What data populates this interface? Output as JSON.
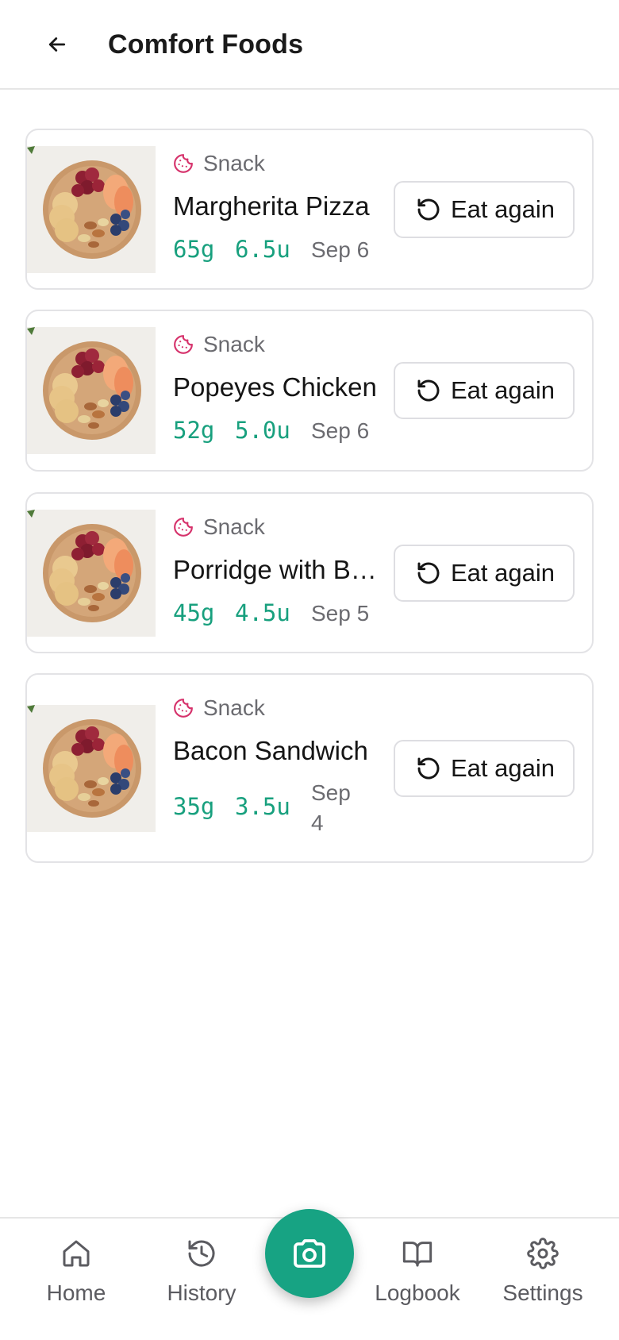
{
  "header": {
    "title": "Comfort Foods",
    "back_icon": "arrow-left-icon"
  },
  "colors": {
    "accent": "#17a383",
    "category": "#d6336c",
    "border": "#e3e3e6"
  },
  "meals": [
    {
      "category": "Snack",
      "name": "Margherita Pizza",
      "carbs": "65g",
      "units": "6.5u",
      "date": "Sep 6",
      "action": "Eat again"
    },
    {
      "category": "Snack",
      "name": "Popeyes Chicken",
      "carbs": "52g",
      "units": "5.0u",
      "date": "Sep 6",
      "action": "Eat again"
    },
    {
      "category": "Snack",
      "name": "Porridge with Berries",
      "carbs": "45g",
      "units": "4.5u",
      "date": "Sep 5",
      "action": "Eat again"
    },
    {
      "category": "Snack",
      "name": "Bacon Sandwich",
      "carbs": "35g",
      "units": "3.5u",
      "date": "Sep 4",
      "action": "Eat again"
    }
  ],
  "nav": {
    "home": "Home",
    "history": "History",
    "logbook": "Logbook",
    "settings": "Settings",
    "camera_icon": "camera-icon"
  }
}
